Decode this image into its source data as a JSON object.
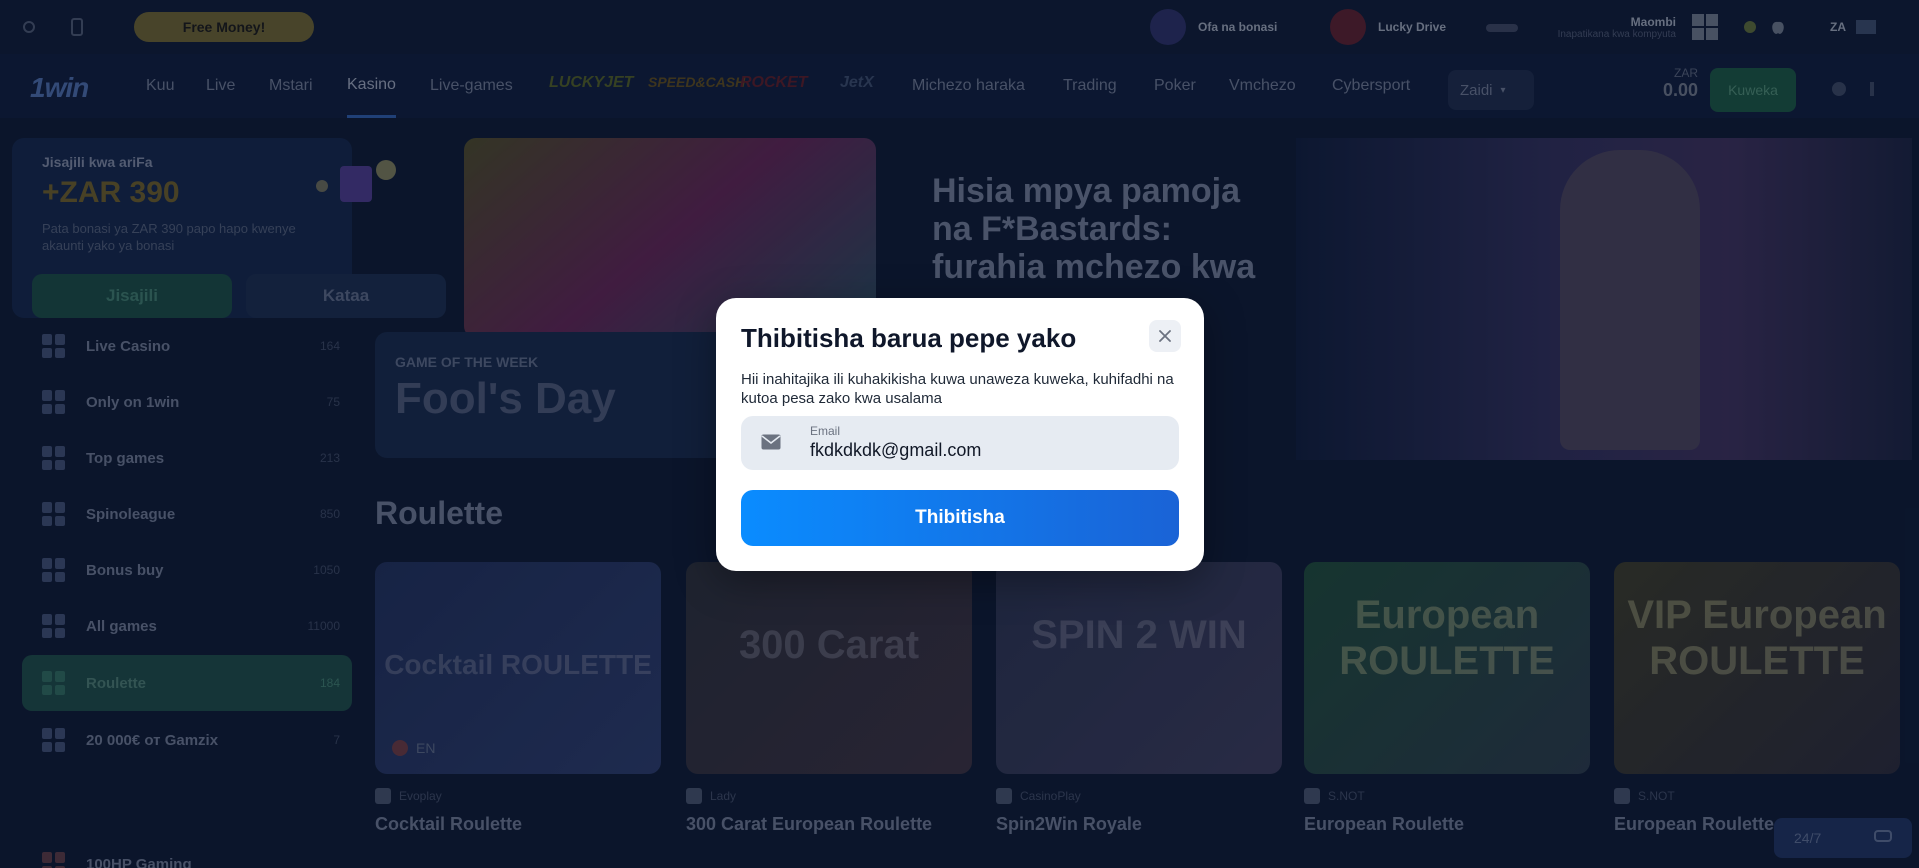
{
  "topbar": {
    "promo": "Free Money!",
    "offers": "Ofa na bonasi",
    "lucky": "Lucky Drive",
    "app_title": "Maombi",
    "app_sub": "Inapatikana kwa kompyuta",
    "region": "ZA"
  },
  "nav": {
    "logo": "1win",
    "items": [
      "Kuu",
      "Live",
      "Mstari",
      "Kasino",
      "Live-games"
    ],
    "brands": [
      "LUCKYJET",
      "SPEED&CASH",
      "ROCKET",
      "JetX"
    ],
    "items2": [
      "Michezo haraka",
      "Trading",
      "Poker",
      "Vmchezo",
      "Cybersport"
    ],
    "more": "Zaidi",
    "currency": "ZAR",
    "balance": "0.00",
    "deposit": "Kuweka"
  },
  "sidebar": {
    "reg_title": "Jisajili kwa ariFa",
    "reg_amount": "+ZAR 390",
    "reg_desc": "Pata bonasi ya ZAR 390 papo hapo kwenye akaunti yako ya bonasi",
    "register": "Jisajili",
    "decline": "Kataa",
    "items": [
      {
        "label": "Live Casino",
        "count": "164"
      },
      {
        "label": "Only on 1win",
        "count": "75"
      },
      {
        "label": "Top games",
        "count": "213"
      },
      {
        "label": "Spinoleague",
        "count": "850"
      },
      {
        "label": "Bonus buy",
        "count": "1050"
      },
      {
        "label": "All games",
        "count": "11000"
      },
      {
        "label": "Roulette",
        "count": "184"
      },
      {
        "label": "20 000€ от Gamzix",
        "count": "7"
      }
    ],
    "provider_item": "100HP Gaming"
  },
  "content": {
    "gow_sub": "GAME OF THE WEEK",
    "gow_title": "Fool's Day",
    "hero_text": "Hisia mpya pamoja na F*Bastards: furahia mchezo kwa",
    "section_title": "Roulette",
    "games": [
      {
        "name": "Cocktail Roulette",
        "provider": "Evoplay",
        "art": "Cocktail ROULETTE"
      },
      {
        "name": "300 Carat European Roulette",
        "provider": "Lady",
        "art": "300 Carat"
      },
      {
        "name": "Spin2Win Royale",
        "provider": "CasinoPlay",
        "art": "SPIN 2 WIN"
      },
      {
        "name": "European Roulette",
        "provider": "S.NOT",
        "art": "European ROULETTE"
      },
      {
        "name": "European Roulette",
        "provider": "S.NOT",
        "art": "VIP European ROULETTE"
      }
    ],
    "lang_chip": "EN",
    "support": "24/7"
  },
  "modal": {
    "title": "Thibitisha barua pepe yako",
    "desc": "Hii inahitajika ili kuhakikisha kuwa unaweza kuweka, kuhifadhi na kutoa pesa zako kwa usalama",
    "email_label": "Email",
    "email_value": "fkdkdkdk@gmail.com",
    "confirm": "Thibitisha"
  },
  "colors": {
    "accent": "#0a8cff",
    "accent_end": "#1a63d6",
    "page_bg": "#0d1a33"
  }
}
